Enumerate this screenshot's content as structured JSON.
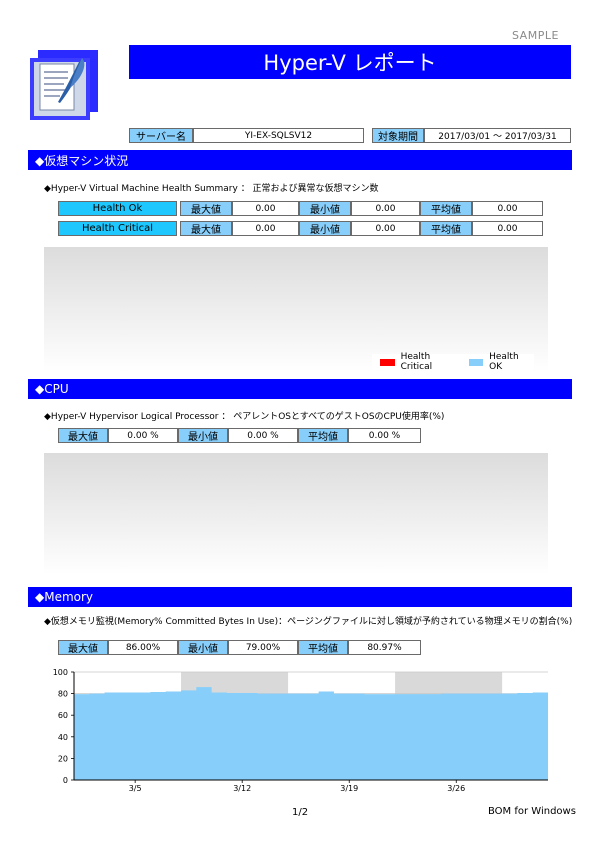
{
  "sample_label": "SAMPLE",
  "title": "Hyper-V レポート",
  "header": {
    "server_label": "サーバー名",
    "server_value": "YI-EX-SQLSV12",
    "period_label": "対象期間",
    "period_value": "2017/03/01 ～ 2017/03/31"
  },
  "sections": {
    "vm": {
      "title": "◆仮想マシン状況",
      "subtitle": "◆Hyper-V Virtual Machine Health Summary ： 正常および異常な仮想マシン数",
      "rows": [
        {
          "name": "Health Ok",
          "max_label": "最大値",
          "max": "0.00",
          "min_label": "最小値",
          "min": "0.00",
          "avg_label": "平均値",
          "avg": "0.00"
        },
        {
          "name": "Health Critical",
          "max_label": "最大値",
          "max": "0.00",
          "min_label": "最小値",
          "min": "0.00",
          "avg_label": "平均値",
          "avg": "0.00"
        }
      ],
      "legend": [
        {
          "name": "Health Critical",
          "color": "#ff0000"
        },
        {
          "name": "Health OK",
          "color": "#87cefa"
        }
      ]
    },
    "cpu": {
      "title": "◆CPU",
      "subtitle": "◆Hyper-V Hypervisor Logical Processor ： ペアレントOSとすべてのゲストOSのCPU使用率(%)",
      "stats": {
        "max_label": "最大値",
        "max": "0.00 %",
        "min_label": "最小値",
        "min": "0.00 %",
        "avg_label": "平均値",
        "avg": "0.00 %"
      }
    },
    "memory": {
      "title": "◆Memory",
      "subtitle": "◆仮想メモリ監視(Memory% Committed Bytes In Use)：ページングファイルに対し領域が予約されている物理メモリの割合(%)",
      "stats": {
        "max_label": "最大値",
        "max": "86.00%",
        "min_label": "最小値",
        "min": "79.00%",
        "avg_label": "平均値",
        "avg": "80.97%"
      }
    }
  },
  "footer": {
    "page": "1/2",
    "product": "BOM for Windows"
  },
  "chart_data": {
    "type": "area",
    "title": "",
    "xlabel": "",
    "ylabel": "",
    "ylim": [
      0,
      100
    ],
    "yticks": [
      0,
      20,
      40,
      60,
      80,
      100
    ],
    "xticks": [
      "3/5",
      "3/12",
      "3/19",
      "3/26"
    ],
    "xlim": [
      "2017/03/01",
      "2017/03/31"
    ],
    "grid": true,
    "series": [
      {
        "color": "#87cefa",
        "x": [
          "2017/03/01",
          "2017/03/02",
          "2017/03/03",
          "2017/03/04",
          "2017/03/05",
          "2017/03/06",
          "2017/03/07",
          "2017/03/08",
          "2017/03/09",
          "2017/03/10",
          "2017/03/11",
          "2017/03/12",
          "2017/03/13",
          "2017/03/14",
          "2017/03/15",
          "2017/03/16",
          "2017/03/17",
          "2017/03/18",
          "2017/03/19",
          "2017/03/20",
          "2017/03/21",
          "2017/03/22",
          "2017/03/23",
          "2017/03/24",
          "2017/03/25",
          "2017/03/26",
          "2017/03/27",
          "2017/03/28",
          "2017/03/29",
          "2017/03/30",
          "2017/03/31"
        ],
        "values": [
          79.5,
          80,
          81,
          81,
          81,
          81.5,
          82,
          83,
          86,
          81,
          80.5,
          80.5,
          80,
          80,
          80,
          80,
          82,
          80,
          80,
          79.5,
          79.5,
          79.5,
          79.5,
          79.5,
          80,
          80,
          80,
          80,
          80,
          80.5,
          81
        ]
      }
    ]
  }
}
